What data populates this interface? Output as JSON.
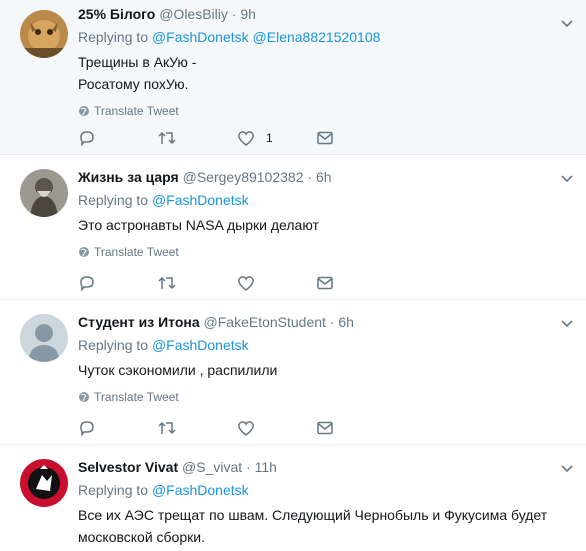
{
  "reply_prefix": "Replying to",
  "translate_label": "Translate Tweet",
  "tweets": [
    {
      "name": "25% Білого",
      "handle": "@OlesBiliy",
      "dot": "·",
      "time": "9h",
      "replying_to": [
        "@FashDonetsk",
        "@Elena8821520108"
      ],
      "text_lines": [
        "Трещины в АкУю -",
        "Росатому похУю."
      ],
      "likes": "1"
    },
    {
      "name": "Жизнь за царя",
      "handle": "@Sergey89102382",
      "dot": "·",
      "time": "6h",
      "replying_to": [
        "@FashDonetsk"
      ],
      "text_lines": [
        "Это астронавты NASA дырки делают"
      ],
      "likes": ""
    },
    {
      "name": "Студент из Итона",
      "handle": "@FakeEtonStudent",
      "dot": "·",
      "time": "6h",
      "replying_to": [
        "@FashDonetsk"
      ],
      "text_lines": [
        "Чуток сэкономили , распилили"
      ],
      "likes": ""
    },
    {
      "name": "Selvestor Vivat",
      "handle": "@S_vivat",
      "dot": "·",
      "time": "11h",
      "replying_to": [
        "@FashDonetsk"
      ],
      "text_lines": [
        "Все их АЭС трещат по швам. Следующий Чернобыль и Фукусима будет",
        "московской сборки."
      ],
      "likes": ""
    }
  ],
  "icons": [
    "reply-icon",
    "retweet-icon",
    "like-icon",
    "message-icon",
    "globe-icon",
    "caret-down-icon"
  ],
  "colors": {
    "link": "#1b95e0",
    "muted": "#657786",
    "highlight_bg": "#f5f8fa",
    "avatar4_bg": "#c8102e"
  }
}
